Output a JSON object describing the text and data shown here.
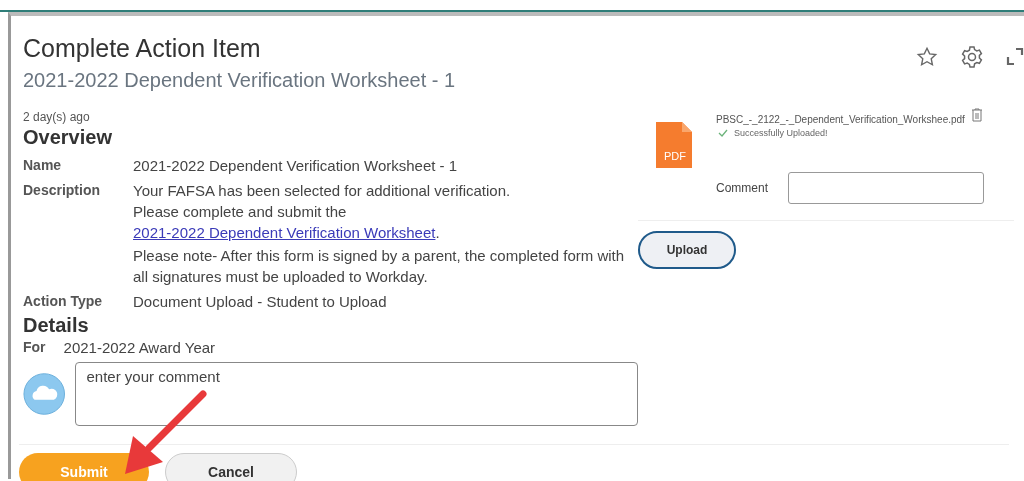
{
  "header": {
    "title": "Complete Action Item",
    "subtitle": "2021-2022 Dependent Verification Worksheet - 1"
  },
  "meta": {
    "age": "2 day(s) ago"
  },
  "overview": {
    "heading": "Overview",
    "fields": [
      {
        "kind": "text",
        "label": "Name",
        "value": "2021-2022 Dependent Verification Worksheet - 1"
      },
      {
        "kind": "description",
        "label": "Description",
        "lines": [
          "Your FAFSA has been selected for additional verification."
        ],
        "link_prefix": "Please complete and submit the ",
        "link": "2021-2022 Dependent Verification Worksheet",
        "link_suffix": ".",
        "note": "Please note- After this form is signed by a parent, the completed form with all signatures must be uploaded to Workday."
      },
      {
        "kind": "text",
        "label": "Action Type",
        "value": "Document Upload - Student to Upload"
      }
    ]
  },
  "details": {
    "heading": "Details",
    "for_label": "For",
    "for_value": "2021-2022 Award Year",
    "comment_placeholder": "enter your comment"
  },
  "attachment": {
    "file_name": "PBSC_-_2122_-_Dependent_Verification_Workshee.pdf",
    "file_type": "PDF",
    "status": "Successfully Uploaded!",
    "comment_label": "Comment",
    "upload_button": "Upload"
  },
  "buttons": [
    {
      "label": "Submit",
      "kind": "primary"
    },
    {
      "label": "Cancel",
      "kind": "secondary"
    }
  ]
}
